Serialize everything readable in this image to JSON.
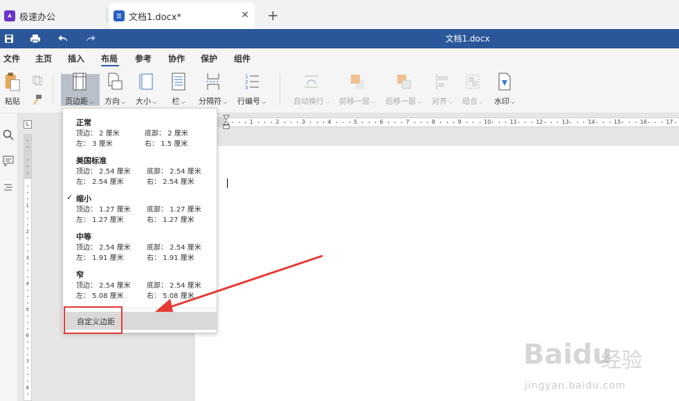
{
  "tabs": [
    {
      "title": "极速办公",
      "icon": "rocket-icon"
    },
    {
      "title": "文档1.docx*",
      "icon": "document-icon"
    }
  ],
  "titlebar": {
    "doc_title": "文档1.docx"
  },
  "menu": [
    "文件",
    "主页",
    "插入",
    "布局",
    "参考",
    "协作",
    "保护",
    "组件"
  ],
  "ribbon": {
    "paste": "粘贴",
    "margins": "页边距",
    "orientation": "方向",
    "size": "大小",
    "columns": "栏",
    "breaks": "分隔符",
    "line_numbers": "行编号",
    "wrap": "自动换行",
    "bring_forward": "前移一层",
    "send_backward": "后移一层",
    "align": "对齐",
    "group": "组合",
    "watermark": "水印"
  },
  "margin_presets": [
    {
      "name": "正常",
      "top": "顶边： 2 厘米",
      "bottom": "底部： 2 厘米",
      "left": "左： 3 厘米",
      "right": "右： 1.5 厘米",
      "checked": false
    },
    {
      "name": "美国标准",
      "top": "顶边： 2.54 厘米",
      "bottom": "底部： 2.54 厘米",
      "left": "左： 2.54 厘米",
      "right": "右： 2.54 厘米",
      "checked": false
    },
    {
      "name": "缩小",
      "top": "顶边： 1.27 厘米",
      "bottom": "底部： 1.27 厘米",
      "left": "左： 1.27 厘米",
      "right": "右： 1.27 厘米",
      "checked": true
    },
    {
      "name": "中等",
      "top": "顶边： 2.54 厘米",
      "bottom": "底部： 2.54 厘米",
      "left": "左： 1.91 厘米",
      "right": "右： 1.91 厘米",
      "checked": false
    },
    {
      "name": "窄",
      "top": "顶边： 2.54 厘米",
      "bottom": "底部： 2.54 厘米",
      "left": "左： 5.08 厘米",
      "right": "右： 5.08 厘米",
      "checked": false
    }
  ],
  "custom_margins": "自定义边距",
  "check_mark": "✓",
  "ruler_numbers": [
    "1",
    "2",
    "3",
    "4",
    "5",
    "6",
    "7",
    "8",
    "9",
    "10",
    "11",
    "12",
    "13",
    "14",
    "15",
    "16",
    "17"
  ],
  "vruler_numbers": [
    "1",
    "2",
    "3",
    "4",
    "5",
    "6",
    "7",
    "8",
    "9"
  ],
  "watermark": {
    "main": "Baidu",
    "cn": "经验",
    "url": "jingyan.baidu.com"
  },
  "colors": {
    "titlebar": "#2b579a",
    "highlight": "#e53935",
    "active": "#b9c0cb"
  }
}
